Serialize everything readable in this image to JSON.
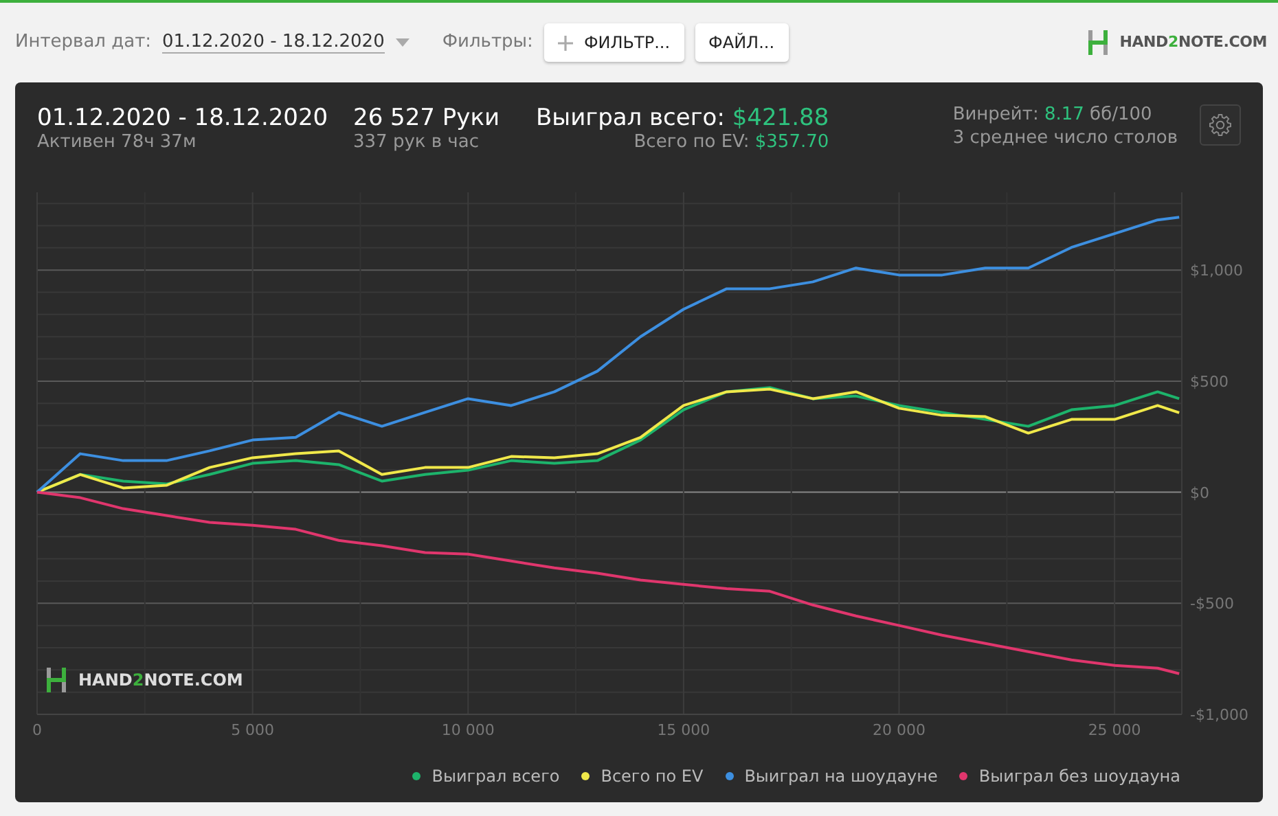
{
  "toolbar": {
    "date_label": "Интервал дат:",
    "date_value": "01.12.2020 - 18.12.2020",
    "filters_label": "Фильтры:",
    "buttons": [
      {
        "kind": "add",
        "label": "ФИЛЬТР..."
      },
      {
        "kind": "plain",
        "label": "ФАЙЛ..."
      }
    ],
    "logo": {
      "before": "HAND",
      "accent": "2",
      "after": "NOTE.COM"
    }
  },
  "summary": {
    "period": "01.12.2020 - 18.12.2020",
    "active": "Активен 78ч 37м",
    "hands": "26 527 Руки",
    "hands_rate": "337 рук в час",
    "won_label": "Выиграл всего:",
    "won_value": "$421.88",
    "ev_label": "Всего по EV:",
    "ev_value": "$357.70",
    "winrate_label": "Винрейт:",
    "winrate_value": "8.17",
    "winrate_unit": "бб/100",
    "tables": "3 среднее число столов"
  },
  "chart": {
    "watermark": {
      "before": "HAND",
      "accent": "2",
      "after": "NOTE.COM"
    },
    "chart_data": {
      "type": "line",
      "grid": true,
      "x": [
        0,
        1000,
        2000,
        3000,
        4000,
        5000,
        6000,
        7000,
        8000,
        9000,
        10000,
        11000,
        12000,
        13000,
        14000,
        15000,
        16000,
        17000,
        18000,
        19000,
        20000,
        21000,
        22000,
        23000,
        24000,
        25000,
        26000,
        26500
      ],
      "series": [
        {
          "name": "Выиграл всего",
          "color": "#1db36b",
          "values": [
            0,
            80,
            50,
            37,
            80,
            130,
            142,
            124,
            50,
            80,
            99,
            142,
            130,
            142,
            235,
            371,
            452,
            471,
            421,
            433,
            390,
            359,
            328,
            297,
            371,
            390,
            452,
            421
          ]
        },
        {
          "name": "Всего по EV",
          "color": "#f0e84a",
          "values": [
            0,
            80,
            19,
            31,
            111,
            155,
            173,
            186,
            80,
            111,
            111,
            161,
            155,
            173,
            247,
            390,
            452,
            464,
            421,
            452,
            378,
            346,
            340,
            266,
            328,
            328,
            390,
            358
          ]
        },
        {
          "name": "Выиграл на шоудауне",
          "color": "#3d8fe0",
          "values": [
            0,
            173,
            142,
            142,
            186,
            235,
            247,
            359,
            297,
            359,
            421,
            390,
            452,
            545,
            700,
            824,
            916,
            916,
            947,
            1009,
            978,
            978,
            1009,
            1009,
            1102,
            1164,
            1226,
            1238
          ]
        },
        {
          "name": "Выиграл без шоудауна",
          "color": "#e0366d",
          "values": [
            0,
            -25,
            -74,
            -105,
            -136,
            -149,
            -167,
            -217,
            -241,
            -272,
            -279,
            -310,
            -341,
            -365,
            -396,
            -415,
            -434,
            -446,
            -508,
            -557,
            -600,
            -644,
            -681,
            -718,
            -755,
            -780,
            -792,
            -817
          ]
        }
      ],
      "xlim": [
        0,
        26560
      ],
      "ylim": [
        -1000,
        1350
      ],
      "xticks": [
        {
          "value": 0,
          "label": "0"
        },
        {
          "value": 5000,
          "label": "5 000"
        },
        {
          "value": 10000,
          "label": "10 000"
        },
        {
          "value": 15000,
          "label": "15 000"
        },
        {
          "value": 20000,
          "label": "20 000"
        },
        {
          "value": 25000,
          "label": "25 000"
        }
      ],
      "yticks": [
        {
          "value": 1000,
          "label": "$1,000"
        },
        {
          "value": 500,
          "label": "$500"
        },
        {
          "value": 0,
          "label": "$0"
        },
        {
          "value": -500,
          "label": "-$500"
        },
        {
          "value": -1000,
          "label": "-$1,000"
        }
      ]
    }
  }
}
